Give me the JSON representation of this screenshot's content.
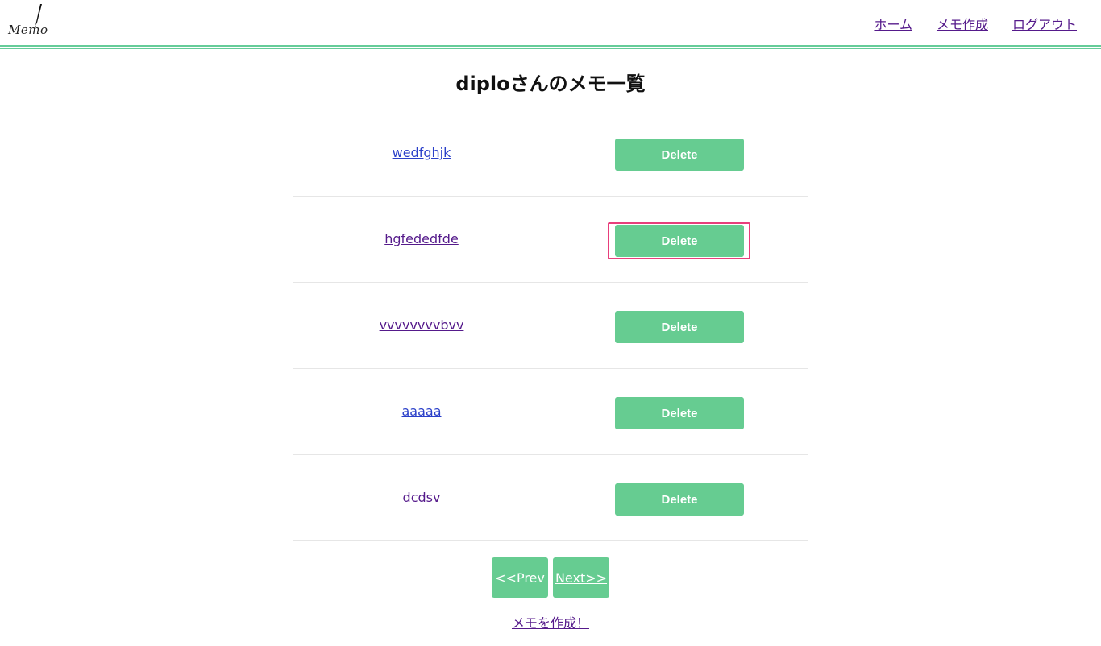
{
  "brand": {
    "logo_text": "Memo",
    "logo_icon": "pen-icon"
  },
  "nav": {
    "items": [
      "ホーム",
      "メモ作成",
      "ログアウト"
    ]
  },
  "page": {
    "title": "diploさんのメモ一覧"
  },
  "memos": [
    {
      "title": "wedfghjk",
      "delete_label": "Delete"
    },
    {
      "title": "hgfededfde",
      "delete_label": "Delete"
    },
    {
      "title": "vvvvvvvvbvv",
      "delete_label": "Delete"
    },
    {
      "title": "aaaaa",
      "delete_label": "Delete"
    },
    {
      "title": "dcdsv",
      "delete_label": "Delete"
    }
  ],
  "pagination": {
    "prev_label": "<<Prev",
    "next_label": "Next>>"
  },
  "create_link": "メモを作成！",
  "colors": {
    "accent": "#66cc91",
    "highlight": "#e83e7b",
    "link_visited": "#551a8b",
    "link": "#2a3fc9"
  }
}
